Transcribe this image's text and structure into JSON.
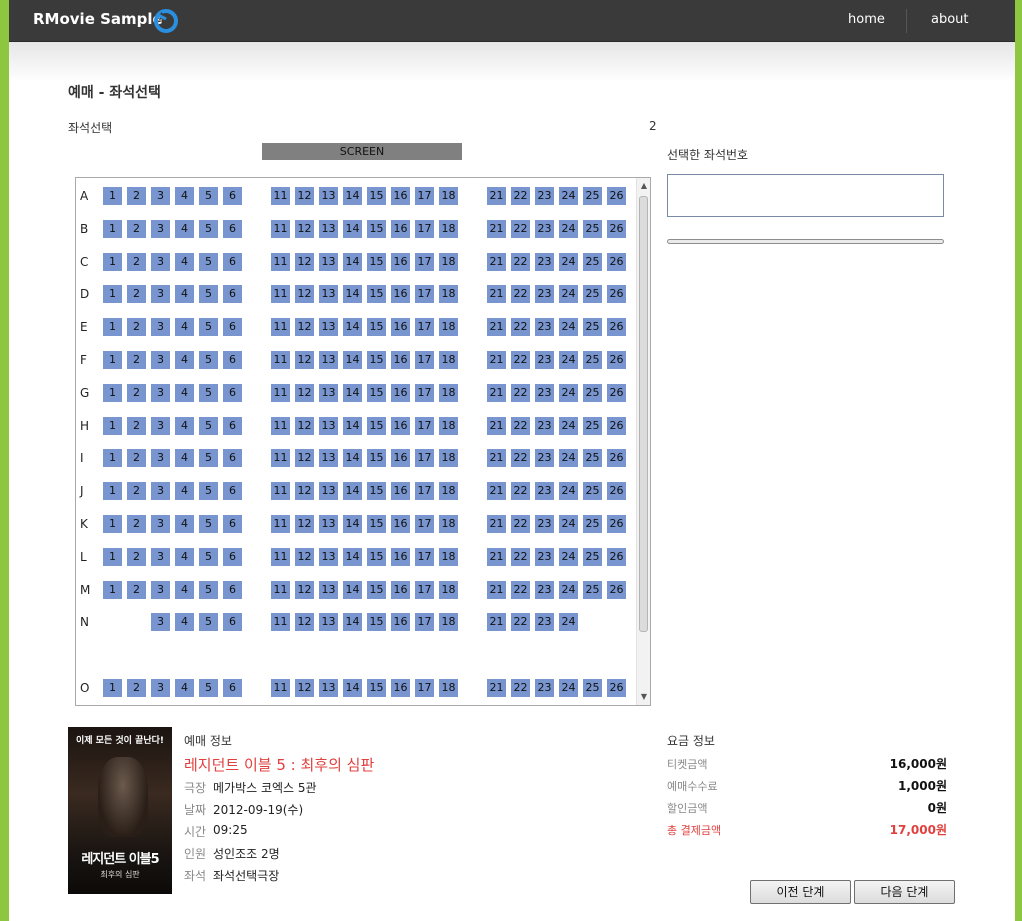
{
  "app": {
    "brand": "RMovie Sample",
    "nav": {
      "home": "home",
      "about": "about"
    }
  },
  "page": {
    "title": "예매 - 좌석선택",
    "seat_select_label": "좌석선택",
    "seat_count": "2",
    "selected_seats_label": "선택한 좌석번호",
    "selected_seats_value": "",
    "screen_label": "SCREEN",
    "progress": 0
  },
  "seat_map": {
    "rows": [
      {
        "label": "A",
        "seats": [
          "1",
          "2",
          "3",
          "4",
          "5",
          "6",
          "11",
          "12",
          "13",
          "14",
          "15",
          "16",
          "17",
          "18",
          "21",
          "22",
          "23",
          "24",
          "25",
          "26"
        ]
      },
      {
        "label": "B",
        "seats": [
          "1",
          "2",
          "3",
          "4",
          "5",
          "6",
          "11",
          "12",
          "13",
          "14",
          "15",
          "16",
          "17",
          "18",
          "21",
          "22",
          "23",
          "24",
          "25",
          "26"
        ]
      },
      {
        "label": "C",
        "seats": [
          "1",
          "2",
          "3",
          "4",
          "5",
          "6",
          "11",
          "12",
          "13",
          "14",
          "15",
          "16",
          "17",
          "18",
          "21",
          "22",
          "23",
          "24",
          "25",
          "26"
        ]
      },
      {
        "label": "D",
        "seats": [
          "1",
          "2",
          "3",
          "4",
          "5",
          "6",
          "11",
          "12",
          "13",
          "14",
          "15",
          "16",
          "17",
          "18",
          "21",
          "22",
          "23",
          "24",
          "25",
          "26"
        ]
      },
      {
        "label": "E",
        "seats": [
          "1",
          "2",
          "3",
          "4",
          "5",
          "6",
          "11",
          "12",
          "13",
          "14",
          "15",
          "16",
          "17",
          "18",
          "21",
          "22",
          "23",
          "24",
          "25",
          "26"
        ]
      },
      {
        "label": "F",
        "seats": [
          "1",
          "2",
          "3",
          "4",
          "5",
          "6",
          "11",
          "12",
          "13",
          "14",
          "15",
          "16",
          "17",
          "18",
          "21",
          "22",
          "23",
          "24",
          "25",
          "26"
        ]
      },
      {
        "label": "G",
        "seats": [
          "1",
          "2",
          "3",
          "4",
          "5",
          "6",
          "11",
          "12",
          "13",
          "14",
          "15",
          "16",
          "17",
          "18",
          "21",
          "22",
          "23",
          "24",
          "25",
          "26"
        ]
      },
      {
        "label": "H",
        "seats": [
          "1",
          "2",
          "3",
          "4",
          "5",
          "6",
          "11",
          "12",
          "13",
          "14",
          "15",
          "16",
          "17",
          "18",
          "21",
          "22",
          "23",
          "24",
          "25",
          "26"
        ]
      },
      {
        "label": "I",
        "seats": [
          "1",
          "2",
          "3",
          "4",
          "5",
          "6",
          "11",
          "12",
          "13",
          "14",
          "15",
          "16",
          "17",
          "18",
          "21",
          "22",
          "23",
          "24",
          "25",
          "26"
        ]
      },
      {
        "label": "J",
        "seats": [
          "1",
          "2",
          "3",
          "4",
          "5",
          "6",
          "11",
          "12",
          "13",
          "14",
          "15",
          "16",
          "17",
          "18",
          "21",
          "22",
          "23",
          "24",
          "25",
          "26"
        ]
      },
      {
        "label": "K",
        "seats": [
          "1",
          "2",
          "3",
          "4",
          "5",
          "6",
          "11",
          "12",
          "13",
          "14",
          "15",
          "16",
          "17",
          "18",
          "21",
          "22",
          "23",
          "24",
          "25",
          "26"
        ]
      },
      {
        "label": "L",
        "seats": [
          "1",
          "2",
          "3",
          "4",
          "5",
          "6",
          "11",
          "12",
          "13",
          "14",
          "15",
          "16",
          "17",
          "18",
          "21",
          "22",
          "23",
          "24",
          "25",
          "26"
        ]
      },
      {
        "label": "M",
        "seats": [
          "1",
          "2",
          "3",
          "4",
          "5",
          "6",
          "11",
          "12",
          "13",
          "14",
          "15",
          "16",
          "17",
          "18",
          "21",
          "22",
          "23",
          "24",
          "25",
          "26"
        ]
      },
      {
        "label": "N",
        "seats": [
          "3",
          "4",
          "5",
          "6",
          "11",
          "12",
          "13",
          "14",
          "15",
          "16",
          "17",
          "18",
          "21",
          "22",
          "23",
          "24"
        ]
      },
      {
        "label": "",
        "seats": []
      },
      {
        "label": "O",
        "seats": [
          "1",
          "2",
          "3",
          "4",
          "5",
          "6",
          "11",
          "12",
          "13",
          "14",
          "15",
          "16",
          "17",
          "18",
          "21",
          "22",
          "23",
          "24",
          "25",
          "26"
        ]
      }
    ]
  },
  "booking": {
    "section_label": "예매 정보",
    "movie_title": "레지던트 이블 5 : 최후의 심판",
    "theater_label": "극장",
    "theater": "메가박스 코엑스 5관",
    "date_label": "날짜",
    "date": "2012-09-19(수)",
    "time_label": "시간",
    "time": "09:25",
    "people_label": "인원",
    "people": "성인조조 2명",
    "seat_label": "좌석",
    "seat": "좌석선택극장"
  },
  "poster": {
    "tagline": "이제 모든 것이 끝난다!",
    "title": "레지던트 이블5",
    "subtitle": "최후의 심판"
  },
  "fees": {
    "section_label": "요금 정보",
    "ticket_label": "티켓금액",
    "ticket": "16,000원",
    "booking_fee_label": "예매수수료",
    "booking_fee": "1,000원",
    "discount_label": "할인금액",
    "discount": "0원",
    "total_label": "총 결제금액",
    "total": "17,000원",
    "total_color": "#e0413f"
  },
  "buttons": {
    "prev": "이전 단계",
    "next": "다음 단계"
  }
}
